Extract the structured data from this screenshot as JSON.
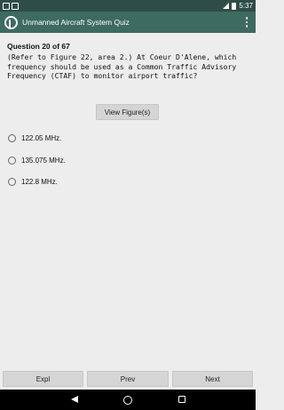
{
  "status_bar": {
    "time": "5:37"
  },
  "app_bar": {
    "title": "Unmanned Aircraft System Quiz"
  },
  "question": {
    "number_label": "Question 20 of 67",
    "text": "(Refer to Figure 22, area 2.) At Coeur D'Alene, which frequency should be used as a Common Traffic Advisory Frequency (CTAF) to monitor airport traffic?",
    "view_figure_label": "View Figure(s)",
    "options": [
      {
        "label": "122.05 MHz."
      },
      {
        "label": "135.075 MHz."
      },
      {
        "label": "122.8 MHz."
      }
    ]
  },
  "bottom_bar": {
    "expl_label": "Expl",
    "prev_label": "Prev",
    "next_label": "Next"
  },
  "colors": {
    "status_bar": "#2f4d47",
    "app_bar": "#3d6a61",
    "background": "#ededed",
    "button": "#d5d5d5"
  }
}
